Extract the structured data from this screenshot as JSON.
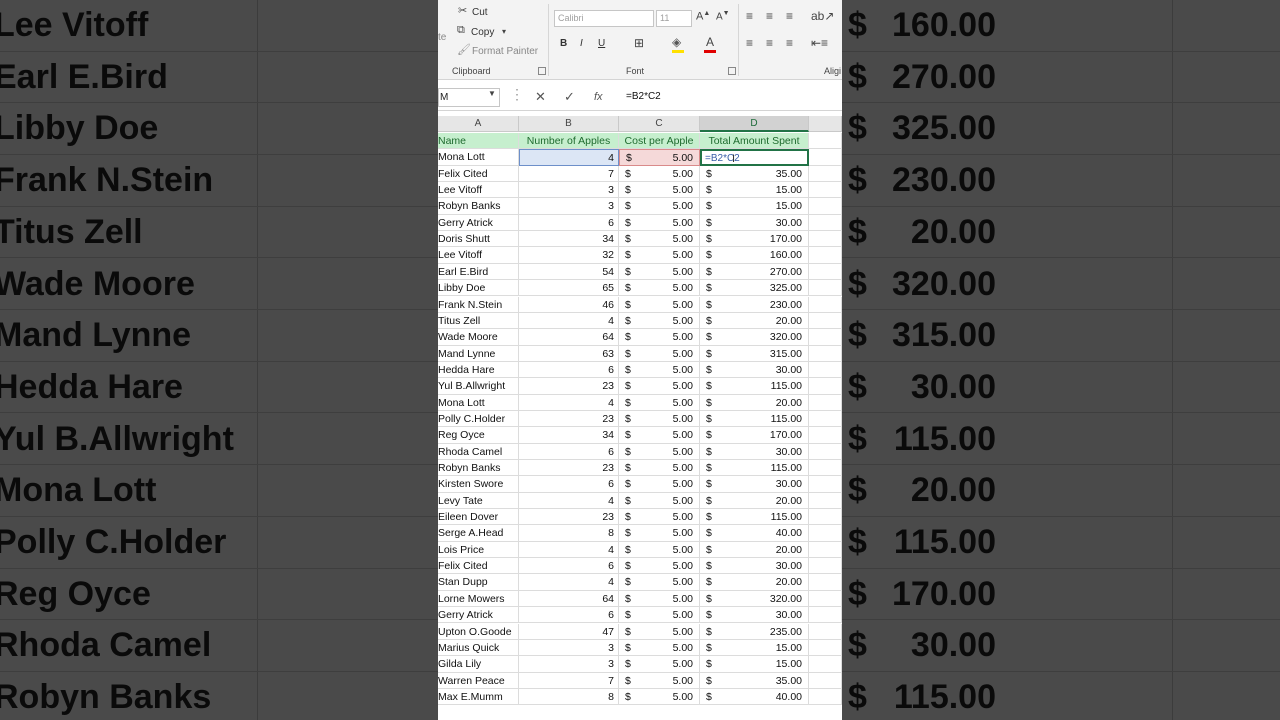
{
  "background_rows": [
    {
      "name": "Lee Vitoff",
      "dollar": "$",
      "amount": "160.00"
    },
    {
      "name": "Earl E.Bird",
      "dollar": "$",
      "amount": "270.00"
    },
    {
      "name": "Libby Doe",
      "dollar": "$",
      "amount": "325.00"
    },
    {
      "name": "Frank N.Stein",
      "dollar": "$",
      "amount": "230.00"
    },
    {
      "name": "Titus Zell",
      "dollar": "$",
      "amount": "20.00"
    },
    {
      "name": "Wade Moore",
      "dollar": "$",
      "amount": "320.00"
    },
    {
      "name": "Mand Lynne",
      "dollar": "$",
      "amount": "315.00"
    },
    {
      "name": "Hedda Hare",
      "dollar": "$",
      "amount": "30.00"
    },
    {
      "name": "Yul B.Allwright",
      "dollar": "$",
      "amount": "115.00"
    },
    {
      "name": "Mona Lott",
      "dollar": "$",
      "amount": "20.00"
    },
    {
      "name": "Polly C.Holder",
      "dollar": "$",
      "amount": "115.00"
    },
    {
      "name": "Reg Oyce",
      "dollar": "$",
      "amount": "170.00"
    },
    {
      "name": "Rhoda Camel",
      "dollar": "$",
      "amount": "30.00"
    },
    {
      "name": "Robyn Banks",
      "dollar": "$",
      "amount": "115.00"
    }
  ],
  "ribbon": {
    "paste_partial": "te",
    "cut": "Cut",
    "copy": "Copy",
    "format_painter": "Format Painter",
    "clipboard_group": "Clipboard",
    "font_name": "Calibri",
    "font_size": "11",
    "bold": "B",
    "italic": "I",
    "underline": "U",
    "font_group": "Font",
    "align_group": "Aligi"
  },
  "formula_bar": {
    "name_box": "M",
    "cancel": "✕",
    "enter": "✓",
    "fx": "fx",
    "formula": "=B2*C2"
  },
  "columns": [
    "A",
    "B",
    "C",
    "D"
  ],
  "headers": {
    "name": "Name",
    "apples": "Number of Apples",
    "cost": "Cost per Apple",
    "total": "Total Amount Spent"
  },
  "editing_cell_text": "=B2*C2",
  "currency_symbol": "$",
  "rows": [
    {
      "name": "Mona Lott",
      "apples": "4",
      "cost": "5.00",
      "total": ""
    },
    {
      "name": "Felix Cited",
      "apples": "7",
      "cost": "5.00",
      "total": "35.00"
    },
    {
      "name": "Lee Vitoff",
      "apples": "3",
      "cost": "5.00",
      "total": "15.00"
    },
    {
      "name": "Robyn Banks",
      "apples": "3",
      "cost": "5.00",
      "total": "15.00"
    },
    {
      "name": "Gerry Atrick",
      "apples": "6",
      "cost": "5.00",
      "total": "30.00"
    },
    {
      "name": "Doris Shutt",
      "apples": "34",
      "cost": "5.00",
      "total": "170.00"
    },
    {
      "name": "Lee Vitoff",
      "apples": "32",
      "cost": "5.00",
      "total": "160.00"
    },
    {
      "name": "Earl E.Bird",
      "apples": "54",
      "cost": "5.00",
      "total": "270.00"
    },
    {
      "name": "Libby Doe",
      "apples": "65",
      "cost": "5.00",
      "total": "325.00"
    },
    {
      "name": "Frank N.Stein",
      "apples": "46",
      "cost": "5.00",
      "total": "230.00"
    },
    {
      "name": "Titus Zell",
      "apples": "4",
      "cost": "5.00",
      "total": "20.00"
    },
    {
      "name": "Wade Moore",
      "apples": "64",
      "cost": "5.00",
      "total": "320.00"
    },
    {
      "name": "Mand Lynne",
      "apples": "63",
      "cost": "5.00",
      "total": "315.00"
    },
    {
      "name": "Hedda Hare",
      "apples": "6",
      "cost": "5.00",
      "total": "30.00"
    },
    {
      "name": "Yul B.Allwright",
      "apples": "23",
      "cost": "5.00",
      "total": "115.00"
    },
    {
      "name": "Mona Lott",
      "apples": "4",
      "cost": "5.00",
      "total": "20.00"
    },
    {
      "name": "Polly C.Holder",
      "apples": "23",
      "cost": "5.00",
      "total": "115.00"
    },
    {
      "name": "Reg Oyce",
      "apples": "34",
      "cost": "5.00",
      "total": "170.00"
    },
    {
      "name": "Rhoda Camel",
      "apples": "6",
      "cost": "5.00",
      "total": "30.00"
    },
    {
      "name": "Robyn Banks",
      "apples": "23",
      "cost": "5.00",
      "total": "115.00"
    },
    {
      "name": "Kirsten Swore",
      "apples": "6",
      "cost": "5.00",
      "total": "30.00"
    },
    {
      "name": "Levy Tate",
      "apples": "4",
      "cost": "5.00",
      "total": "20.00"
    },
    {
      "name": "Eileen Dover",
      "apples": "23",
      "cost": "5.00",
      "total": "115.00"
    },
    {
      "name": "Serge A.Head",
      "apples": "8",
      "cost": "5.00",
      "total": "40.00"
    },
    {
      "name": "Lois Price",
      "apples": "4",
      "cost": "5.00",
      "total": "20.00"
    },
    {
      "name": "Felix Cited",
      "apples": "6",
      "cost": "5.00",
      "total": "30.00"
    },
    {
      "name": "Stan Dupp",
      "apples": "4",
      "cost": "5.00",
      "total": "20.00"
    },
    {
      "name": "Lorne Mowers",
      "apples": "64",
      "cost": "5.00",
      "total": "320.00"
    },
    {
      "name": "Gerry Atrick",
      "apples": "6",
      "cost": "5.00",
      "total": "30.00"
    },
    {
      "name": "Upton O.Goode",
      "apples": "47",
      "cost": "5.00",
      "total": "235.00"
    },
    {
      "name": "Marius Quick",
      "apples": "3",
      "cost": "5.00",
      "total": "15.00"
    },
    {
      "name": "Gilda Lily",
      "apples": "3",
      "cost": "5.00",
      "total": "15.00"
    },
    {
      "name": "Warren Peace",
      "apples": "7",
      "cost": "5.00",
      "total": "35.00"
    },
    {
      "name": "Max E.Mumm",
      "apples": "8",
      "cost": "5.00",
      "total": "40.00"
    }
  ],
  "colors": {
    "header_fill": "#c6efce",
    "header_text": "#1e6b2e",
    "excel_green": "#217346",
    "ref_b_fill": "#dce6f5",
    "ref_c_fill": "#f5d9d9"
  }
}
